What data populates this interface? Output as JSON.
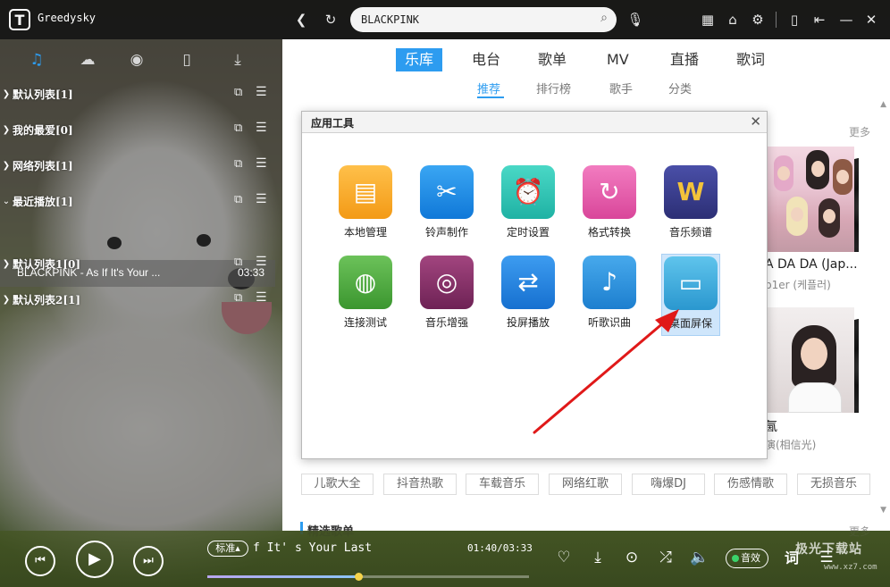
{
  "app": {
    "brand": "Greedysky",
    "search": {
      "value": "BLACKPINK"
    }
  },
  "sidebar": {
    "tabs": [
      {
        "name": "music-note-icon",
        "glyph": "♫"
      },
      {
        "name": "cloud-icon",
        "glyph": "☁"
      },
      {
        "name": "radio-icon",
        "glyph": "◉"
      },
      {
        "name": "phone-icon",
        "glyph": "▯"
      },
      {
        "name": "download-icon",
        "glyph": "⤓"
      }
    ],
    "playlists": [
      {
        "label": "默认列表[1]"
      },
      {
        "label": "我的最爱[0]"
      },
      {
        "label": "网络列表[1]"
      },
      {
        "label": "最近播放[1]"
      },
      {
        "label": "默认列表1[0]"
      },
      {
        "label": "默认列表2[1]"
      }
    ],
    "recent_song": {
      "title": "BLACKPINK - As If It's Your ...",
      "duration": "03:33"
    }
  },
  "main": {
    "nav_tabs": [
      "乐库",
      "电台",
      "歌单",
      "MV",
      "直播",
      "歌词"
    ],
    "sub_tabs": [
      "推荐",
      "排行榜",
      "歌手",
      "分类"
    ],
    "more_label": "更多",
    "albums": [
      {
        "title": "A DA DA (Jap...",
        "artist": "p1er (케플러)"
      },
      {
        "title": "氤",
        "artist": "演(相信光)"
      }
    ],
    "tags": [
      "儿歌大全",
      "抖音热歌",
      "车载音乐",
      "网络红歌",
      "嗨爆DJ",
      "伤感情歌",
      "无损音乐"
    ],
    "section_title": "精选歌单"
  },
  "dialog": {
    "title": "应用工具",
    "tools": [
      {
        "label": "本地管理",
        "icon": "folder-icon",
        "color": "#f6a623",
        "glyph": "▤"
      },
      {
        "label": "铃声制作",
        "icon": "scissors-icon",
        "color": "#1f8fe6",
        "glyph": "✂"
      },
      {
        "label": "定时设置",
        "icon": "alarm-clock-icon",
        "color": "#2bc4b5",
        "glyph": "⏰"
      },
      {
        "label": "格式转换",
        "icon": "convert-icon",
        "color": "#e65aa8",
        "glyph": "↻"
      },
      {
        "label": "音乐频谱",
        "icon": "spectrum-icon",
        "color": "#3b3f8f",
        "glyph": "W"
      },
      {
        "label": "连接测试",
        "icon": "globe-icon",
        "color": "#49a83c",
        "glyph": "◍"
      },
      {
        "label": "音乐增强",
        "icon": "speaker-icon",
        "color": "#8b2f6a",
        "glyph": "◎"
      },
      {
        "label": "投屏播放",
        "icon": "cast-icon",
        "color": "#1e88e5",
        "glyph": "⇄"
      },
      {
        "label": "听歌识曲",
        "icon": "microphone-icon",
        "color": "#2b8fd6",
        "glyph": "♪"
      },
      {
        "label": "桌面屏保",
        "icon": "screensaver-icon",
        "color": "#3aa7d8",
        "glyph": "▭"
      }
    ],
    "selected_index": 9
  },
  "player": {
    "quality": "标准",
    "now_playing": "f It' s Your Last",
    "time": "01:40/03:33",
    "progress_fraction": 0.47,
    "fx_label": "音效",
    "lyric_label": "词",
    "watermark": "极光下载站",
    "watermark_sub": "www.xz7.com"
  }
}
